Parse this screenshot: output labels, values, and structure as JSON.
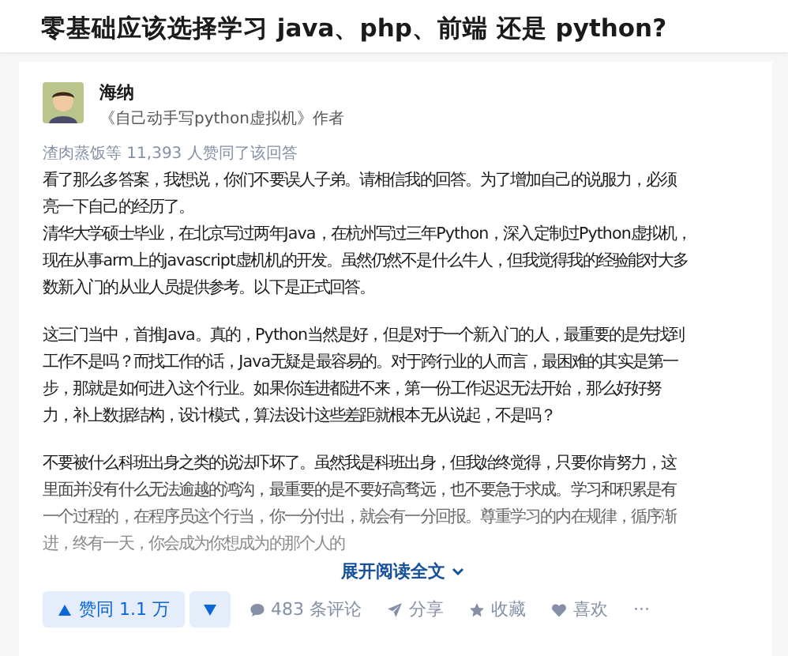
{
  "question": {
    "title": "零基础应该选择学习 java、php、前端 还是 python?"
  },
  "author": {
    "name": "海纳",
    "bio": "《自己动手写python虚拟机》作者"
  },
  "voters": "渣肉蒸饭等 11,393 人赞同了该回答",
  "paragraphs": [
    [
      "看了那么多答案，我想说，你们不要误人子弟。请相信我的回答。为了增加自己的说服力，必须",
      "亮一下自己的经历了。",
      "清华大学硕士毕业，在北京写过两年Java，在杭州写过三年Python，深入定制过Python虚拟机，",
      "现在从事arm上的javascript虚机机的开发。虽然仍然不是什么牛人，但我觉得我的经验能对大多",
      "数新入门的从业人员提供参考。以下是正式回答。"
    ],
    [
      "这三门当中，首推Java。真的，Python当然是好，但是对于一个新入门的人，最重要的是先找到",
      "工作不是吗？而找工作的话，Java无疑是最容易的。对于跨行业的人而言，最困难的其实是第一",
      "步，那就是如何进入这个行业。如果你连进都进不来，第一份工作迟迟无法开始，那么好好努",
      "力，补上数据结构，设计模式，算法设计这些差距就根本无从说起，不是吗？"
    ],
    [
      "不要被什么科班出身之类的说法吓坏了。虽然我是科班出身，但我始终觉得，只要你肯努力，这",
      "里面并没有什么无法逾越的鸿沟，最重要的是不要好高骛远，也不要急于求成。学习和积累是有",
      "一个过程的，在程序员这个行当，你一分付出，就会有一分回报。尊重学习的内在规律，循序渐",
      "进，终有一天，你会成为你想成为的那个人的"
    ]
  ],
  "expand": "展开阅读全文",
  "actions": [
    {
      "kind": "upvote",
      "label": "赞同 1.1 万"
    },
    {
      "kind": "downvote"
    },
    {
      "kind": "comment",
      "label": "483 条评论"
    },
    {
      "kind": "share",
      "label": "分享"
    },
    {
      "kind": "star",
      "label": "收藏"
    },
    {
      "kind": "heart",
      "label": "喜欢"
    },
    {
      "kind": "more",
      "label": "···"
    }
  ]
}
